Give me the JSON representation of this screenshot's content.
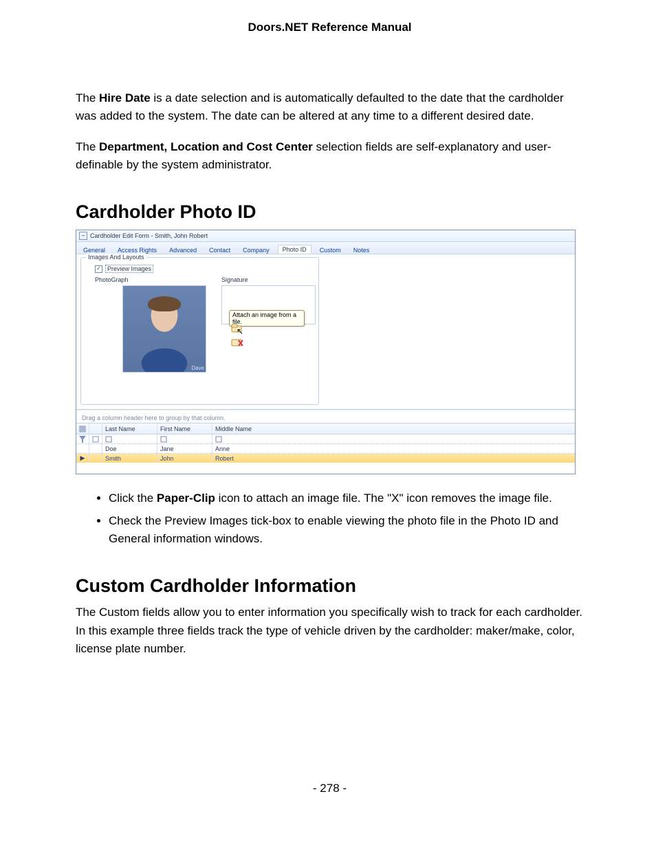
{
  "header": "Doors.NET Reference Manual",
  "para1_pre": "The ",
  "para1_b": "Hire Date",
  "para1_post": " is a date selection and is automatically defaulted to the date that the cardholder was added to the system. The date can be altered at any time to a different desired date.",
  "para2_pre": "The ",
  "para2_b": "Department, Location and Cost Center",
  "para2_post": " selection fields are self-explanatory and user-definable by the system administrator.",
  "h_photoid": "Cardholder Photo ID",
  "shot": {
    "title": "Cardholder Edit Form - Smith, John Robert",
    "tabs": [
      "General",
      "Access Rights",
      "Advanced",
      "Contact",
      "Company",
      "Photo ID",
      "Custom",
      "Notes"
    ],
    "active_tab_index": 5,
    "group_legend": "Images And Layouts",
    "preview_label": "Preview Images",
    "photograph_label": "PhotoGraph",
    "signature_label": "Signature",
    "photo_tag": "Dave",
    "tooltip": "Attach an image from a file.",
    "group_hint": "Drag a column header here to group by that column.",
    "columns": [
      "Last Name",
      "First Name",
      "Middle Name"
    ],
    "rows": [
      {
        "last": "Doe",
        "first": "Jane",
        "middle": "Anne"
      },
      {
        "last": "Smith",
        "first": "John",
        "middle": "Robert"
      }
    ]
  },
  "bullet1_pre": "Click the ",
  "bullet1_b": "Paper-Clip",
  "bullet1_post": " icon to attach an image file. The \"X\" icon removes the image file.",
  "bullet2": "Check the Preview Images tick-box to enable viewing the photo file in the Photo ID and General information windows.",
  "h_custom": "Custom Cardholder Information",
  "para3": "The Custom fields allow you to enter information you specifically wish to track for each cardholder. In this example three fields track the type of vehicle driven by the cardholder: maker/make, color, license plate number.",
  "pageno": "- 278 -"
}
